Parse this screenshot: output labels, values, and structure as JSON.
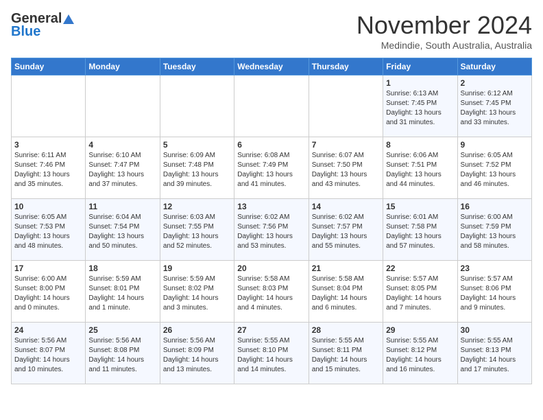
{
  "header": {
    "logo_general": "General",
    "logo_blue": "Blue",
    "month_title": "November 2024",
    "location": "Medindie, South Australia, Australia"
  },
  "days_of_week": [
    "Sunday",
    "Monday",
    "Tuesday",
    "Wednesday",
    "Thursday",
    "Friday",
    "Saturday"
  ],
  "weeks": [
    [
      {
        "day": "",
        "info": ""
      },
      {
        "day": "",
        "info": ""
      },
      {
        "day": "",
        "info": ""
      },
      {
        "day": "",
        "info": ""
      },
      {
        "day": "",
        "info": ""
      },
      {
        "day": "1",
        "info": "Sunrise: 6:13 AM\nSunset: 7:45 PM\nDaylight: 13 hours and 31 minutes."
      },
      {
        "day": "2",
        "info": "Sunrise: 6:12 AM\nSunset: 7:45 PM\nDaylight: 13 hours and 33 minutes."
      }
    ],
    [
      {
        "day": "3",
        "info": "Sunrise: 6:11 AM\nSunset: 7:46 PM\nDaylight: 13 hours and 35 minutes."
      },
      {
        "day": "4",
        "info": "Sunrise: 6:10 AM\nSunset: 7:47 PM\nDaylight: 13 hours and 37 minutes."
      },
      {
        "day": "5",
        "info": "Sunrise: 6:09 AM\nSunset: 7:48 PM\nDaylight: 13 hours and 39 minutes."
      },
      {
        "day": "6",
        "info": "Sunrise: 6:08 AM\nSunset: 7:49 PM\nDaylight: 13 hours and 41 minutes."
      },
      {
        "day": "7",
        "info": "Sunrise: 6:07 AM\nSunset: 7:50 PM\nDaylight: 13 hours and 43 minutes."
      },
      {
        "day": "8",
        "info": "Sunrise: 6:06 AM\nSunset: 7:51 PM\nDaylight: 13 hours and 44 minutes."
      },
      {
        "day": "9",
        "info": "Sunrise: 6:05 AM\nSunset: 7:52 PM\nDaylight: 13 hours and 46 minutes."
      }
    ],
    [
      {
        "day": "10",
        "info": "Sunrise: 6:05 AM\nSunset: 7:53 PM\nDaylight: 13 hours and 48 minutes."
      },
      {
        "day": "11",
        "info": "Sunrise: 6:04 AM\nSunset: 7:54 PM\nDaylight: 13 hours and 50 minutes."
      },
      {
        "day": "12",
        "info": "Sunrise: 6:03 AM\nSunset: 7:55 PM\nDaylight: 13 hours and 52 minutes."
      },
      {
        "day": "13",
        "info": "Sunrise: 6:02 AM\nSunset: 7:56 PM\nDaylight: 13 hours and 53 minutes."
      },
      {
        "day": "14",
        "info": "Sunrise: 6:02 AM\nSunset: 7:57 PM\nDaylight: 13 hours and 55 minutes."
      },
      {
        "day": "15",
        "info": "Sunrise: 6:01 AM\nSunset: 7:58 PM\nDaylight: 13 hours and 57 minutes."
      },
      {
        "day": "16",
        "info": "Sunrise: 6:00 AM\nSunset: 7:59 PM\nDaylight: 13 hours and 58 minutes."
      }
    ],
    [
      {
        "day": "17",
        "info": "Sunrise: 6:00 AM\nSunset: 8:00 PM\nDaylight: 14 hours and 0 minutes."
      },
      {
        "day": "18",
        "info": "Sunrise: 5:59 AM\nSunset: 8:01 PM\nDaylight: 14 hours and 1 minute."
      },
      {
        "day": "19",
        "info": "Sunrise: 5:59 AM\nSunset: 8:02 PM\nDaylight: 14 hours and 3 minutes."
      },
      {
        "day": "20",
        "info": "Sunrise: 5:58 AM\nSunset: 8:03 PM\nDaylight: 14 hours and 4 minutes."
      },
      {
        "day": "21",
        "info": "Sunrise: 5:58 AM\nSunset: 8:04 PM\nDaylight: 14 hours and 6 minutes."
      },
      {
        "day": "22",
        "info": "Sunrise: 5:57 AM\nSunset: 8:05 PM\nDaylight: 14 hours and 7 minutes."
      },
      {
        "day": "23",
        "info": "Sunrise: 5:57 AM\nSunset: 8:06 PM\nDaylight: 14 hours and 9 minutes."
      }
    ],
    [
      {
        "day": "24",
        "info": "Sunrise: 5:56 AM\nSunset: 8:07 PM\nDaylight: 14 hours and 10 minutes."
      },
      {
        "day": "25",
        "info": "Sunrise: 5:56 AM\nSunset: 8:08 PM\nDaylight: 14 hours and 11 minutes."
      },
      {
        "day": "26",
        "info": "Sunrise: 5:56 AM\nSunset: 8:09 PM\nDaylight: 14 hours and 13 minutes."
      },
      {
        "day": "27",
        "info": "Sunrise: 5:55 AM\nSunset: 8:10 PM\nDaylight: 14 hours and 14 minutes."
      },
      {
        "day": "28",
        "info": "Sunrise: 5:55 AM\nSunset: 8:11 PM\nDaylight: 14 hours and 15 minutes."
      },
      {
        "day": "29",
        "info": "Sunrise: 5:55 AM\nSunset: 8:12 PM\nDaylight: 14 hours and 16 minutes."
      },
      {
        "day": "30",
        "info": "Sunrise: 5:55 AM\nSunset: 8:13 PM\nDaylight: 14 hours and 17 minutes."
      }
    ]
  ]
}
